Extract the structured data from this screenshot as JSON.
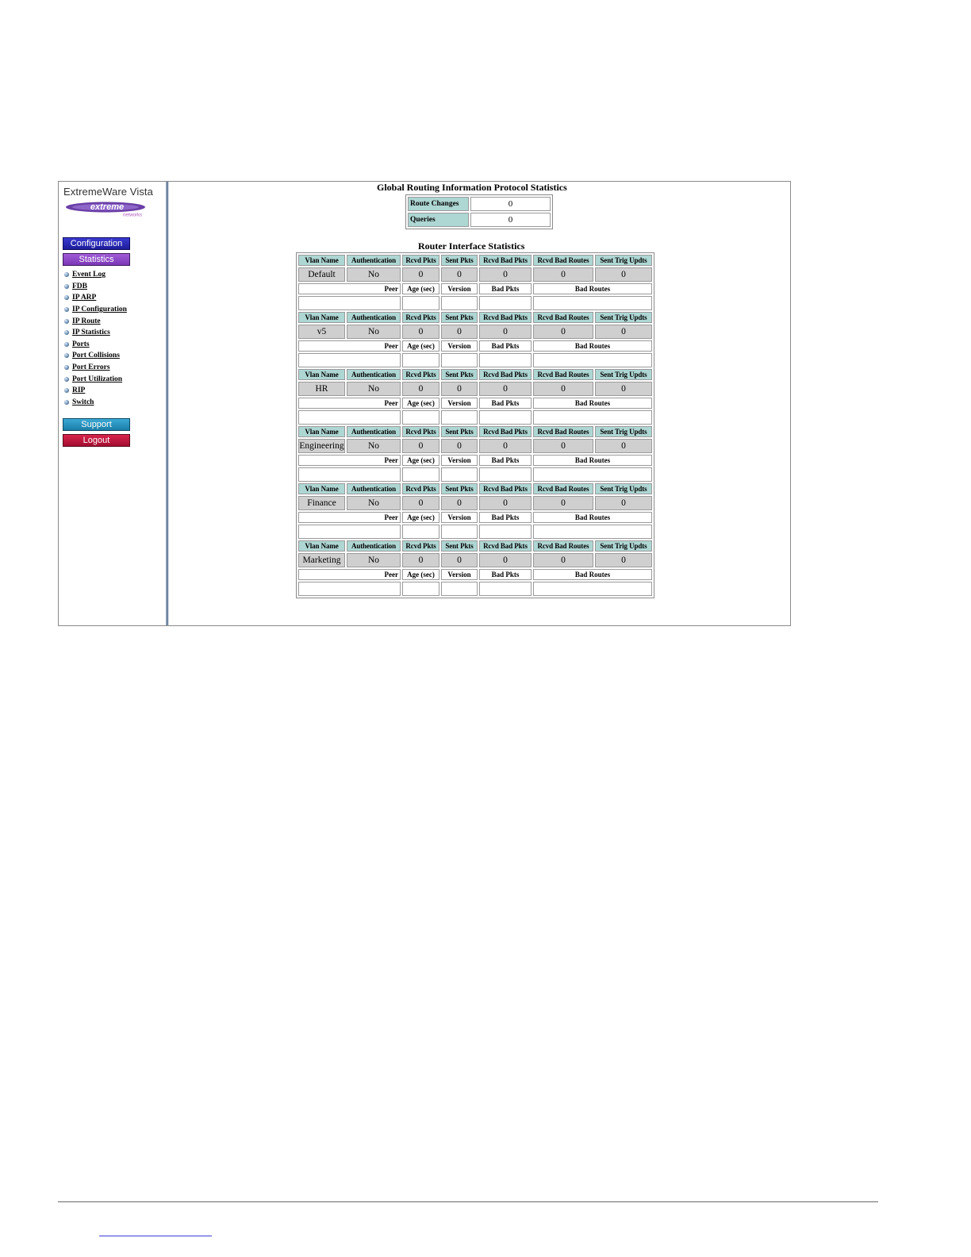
{
  "sidebar": {
    "brand": "ExtremeWare Vista",
    "logo_icon": "extreme-networks-logo",
    "buttons": {
      "configuration": "Configuration",
      "statistics": "Statistics",
      "support": "Support",
      "logout": "Logout"
    },
    "menu": [
      "Event Log",
      "FDB",
      "IP ARP",
      "IP Configuration",
      "IP Route",
      "IP Statistics",
      "Ports",
      "Port Collisions",
      "Port Errors",
      "Port Utilization",
      "RIP",
      "Switch"
    ]
  },
  "global": {
    "title": "Global Routing Information Protocol Statistics",
    "rows": [
      {
        "label": "Route Changes",
        "value": "0"
      },
      {
        "label": "Queries",
        "value": "0"
      }
    ]
  },
  "router": {
    "title": "Router Interface Statistics",
    "headers": [
      "Vlan Name",
      "Authentication",
      "Rcvd Pkts",
      "Sent Pkts",
      "Rcvd Bad Pkts",
      "Rcvd Bad Routes",
      "Sent Trig Updts"
    ],
    "peer_headers": [
      "Peer",
      "Age (sec)",
      "Version",
      "Bad Pkts",
      "Bad Routes"
    ],
    "vlans": [
      {
        "name": "Default",
        "auth": "No",
        "rcvd": "0",
        "sent": "0",
        "bad_pkts": "0",
        "bad_routes": "0",
        "trig": "0"
      },
      {
        "name": "v5",
        "auth": "No",
        "rcvd": "0",
        "sent": "0",
        "bad_pkts": "0",
        "bad_routes": "0",
        "trig": "0"
      },
      {
        "name": "HR",
        "auth": "No",
        "rcvd": "0",
        "sent": "0",
        "bad_pkts": "0",
        "bad_routes": "0",
        "trig": "0"
      },
      {
        "name": "Engineering",
        "auth": "No",
        "rcvd": "0",
        "sent": "0",
        "bad_pkts": "0",
        "bad_routes": "0",
        "trig": "0"
      },
      {
        "name": "Finance",
        "auth": "No",
        "rcvd": "0",
        "sent": "0",
        "bad_pkts": "0",
        "bad_routes": "0",
        "trig": "0"
      },
      {
        "name": "Marketing",
        "auth": "No",
        "rcvd": "0",
        "sent": "0",
        "bad_pkts": "0",
        "bad_routes": "0",
        "trig": "0"
      }
    ]
  },
  "colors": {
    "header_bg": "#aed6d3",
    "value_bg": "#cfcfcf",
    "config_btn": "#2a2ab8",
    "stats_btn": "#8c48c8",
    "support_btn": "#2894c0",
    "logout_btn": "#c0183e"
  }
}
